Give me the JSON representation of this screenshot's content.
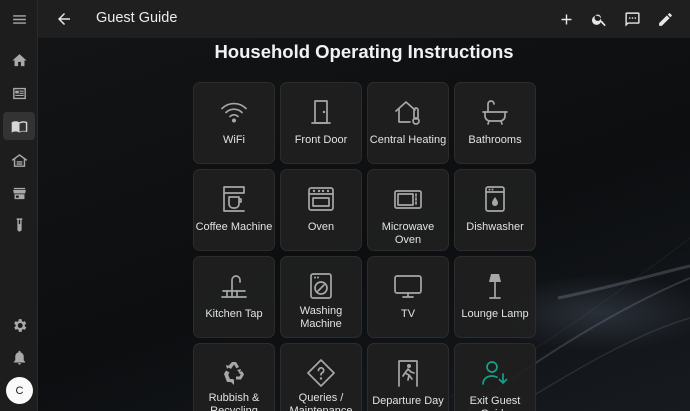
{
  "header": {
    "title": "Guest Guide"
  },
  "sidebar": {
    "avatar_initial": "C"
  },
  "main": {
    "heading": "Household Operating Instructions"
  },
  "cards": [
    {
      "label": "WiFi",
      "icon": "wifi-icon"
    },
    {
      "label": "Front Door",
      "icon": "door-icon"
    },
    {
      "label": "Central Heating",
      "icon": "home-thermometer-icon"
    },
    {
      "label": "Bathrooms",
      "icon": "bathtub-icon"
    },
    {
      "label": "Coffee Machine",
      "icon": "coffee-maker-icon"
    },
    {
      "label": "Oven",
      "icon": "stove-icon"
    },
    {
      "label": "Microwave Oven",
      "icon": "microwave-icon"
    },
    {
      "label": "Dishwasher",
      "icon": "dishwasher-icon"
    },
    {
      "label": "Kitchen Tap",
      "icon": "faucet-icon"
    },
    {
      "label": "Washing Machine",
      "icon": "washing-machine-icon"
    },
    {
      "label": "TV",
      "icon": "tv-icon"
    },
    {
      "label": "Lounge Lamp",
      "icon": "floor-lamp-icon"
    },
    {
      "label": "Rubbish & Recycling",
      "icon": "recycle-icon"
    },
    {
      "label": "Queries / Maintenance",
      "icon": "help-diamond-icon"
    },
    {
      "label": "Departure Day",
      "icon": "exit-run-icon"
    },
    {
      "label": "Exit Guest Guide",
      "icon": "account-arrow-icon"
    }
  ],
  "colors": {
    "accent": "#16a08a",
    "card_bg": "#1f1f1f",
    "header_bg": "#1f1f1f"
  }
}
